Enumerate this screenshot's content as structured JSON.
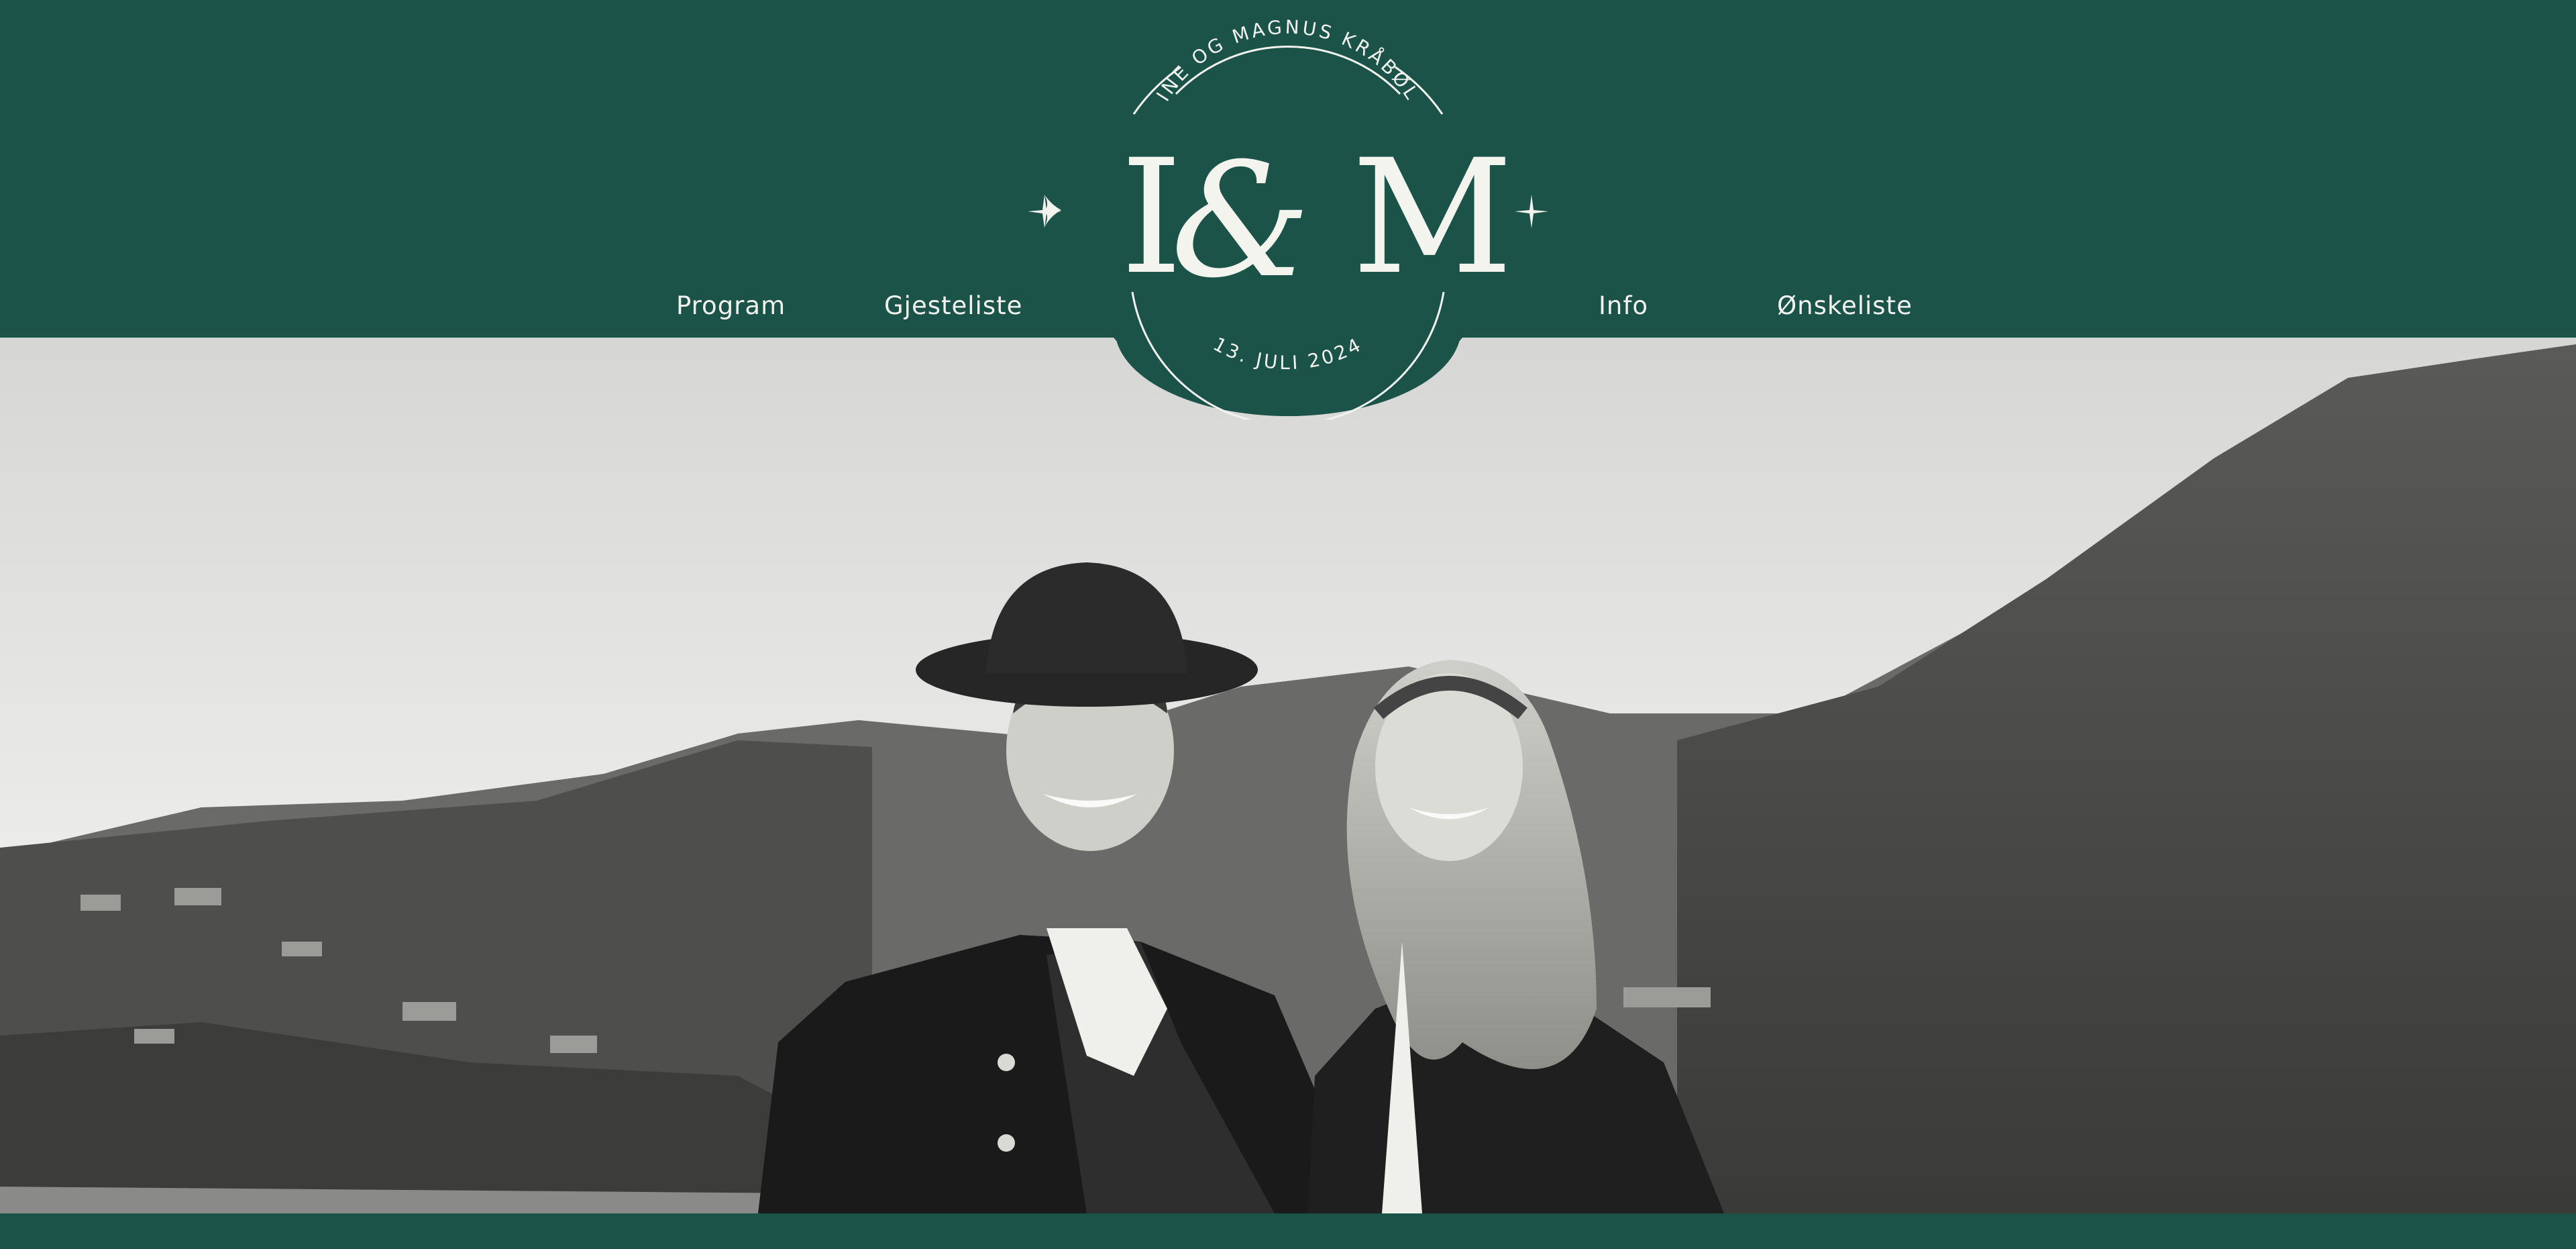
{
  "header": {
    "nav_left": [
      {
        "label": "Program"
      },
      {
        "label": "Gjesteliste"
      }
    ],
    "nav_right": [
      {
        "label": "Info"
      },
      {
        "label": "Ønskeliste"
      }
    ],
    "logo": {
      "names": "INE OG MAGNUS KRÅBØL",
      "monogram_left": "I",
      "ampersand": "&",
      "monogram_right": "M",
      "date": "13. JULI 2024"
    }
  },
  "hero": {
    "image": "couple-in-bunad-photo",
    "style": "black-and-white"
  },
  "colors": {
    "primary_green": "#1b5349",
    "text_light": "#f2f2ee"
  }
}
